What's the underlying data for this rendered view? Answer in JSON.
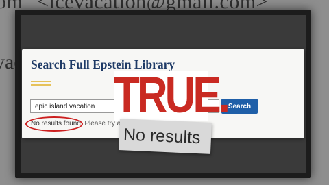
{
  "background": {
    "line1": "om\" <icevacation@gmail.com>\"",
    "line2": "vac"
  },
  "library": {
    "title": "Search Full Epstein Library",
    "search_value": "epic island vacation",
    "search_button": "Search",
    "no_results": "No results found.",
    "hint": " Please try a d"
  },
  "overlay": {
    "verdict": "TRUE.",
    "caption": "No results"
  },
  "colors": {
    "title_navy": "#1e3a66",
    "button_blue": "#1f5fa8",
    "verdict_red": "#c92a22",
    "circle_red": "#cc1f1f",
    "accent_gold": "#e6c25a"
  }
}
